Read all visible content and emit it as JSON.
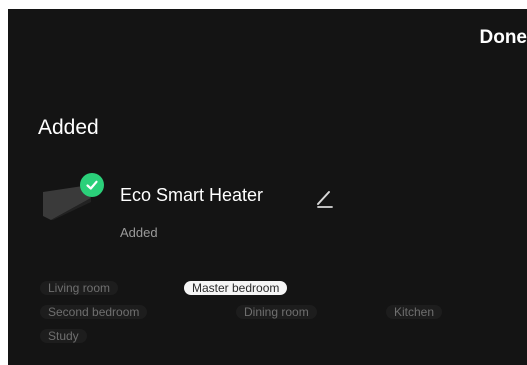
{
  "header": {
    "done_label": "Done"
  },
  "section": {
    "title": "Added"
  },
  "device": {
    "name": "Eco Smart Heater",
    "status": "Added",
    "icon": "heater-device-thumbnail",
    "badge_icon": "check-circle-icon",
    "edit_icon": "pencil-icon",
    "badge_color": "#2bd07a"
  },
  "rooms": {
    "selected": "Master bedroom",
    "items": [
      {
        "label": "Living room"
      },
      {
        "label": "Master bedroom"
      },
      {
        "label": "Second bedroom"
      },
      {
        "label": "Dining room"
      },
      {
        "label": "Kitchen"
      },
      {
        "label": "Study"
      }
    ]
  }
}
